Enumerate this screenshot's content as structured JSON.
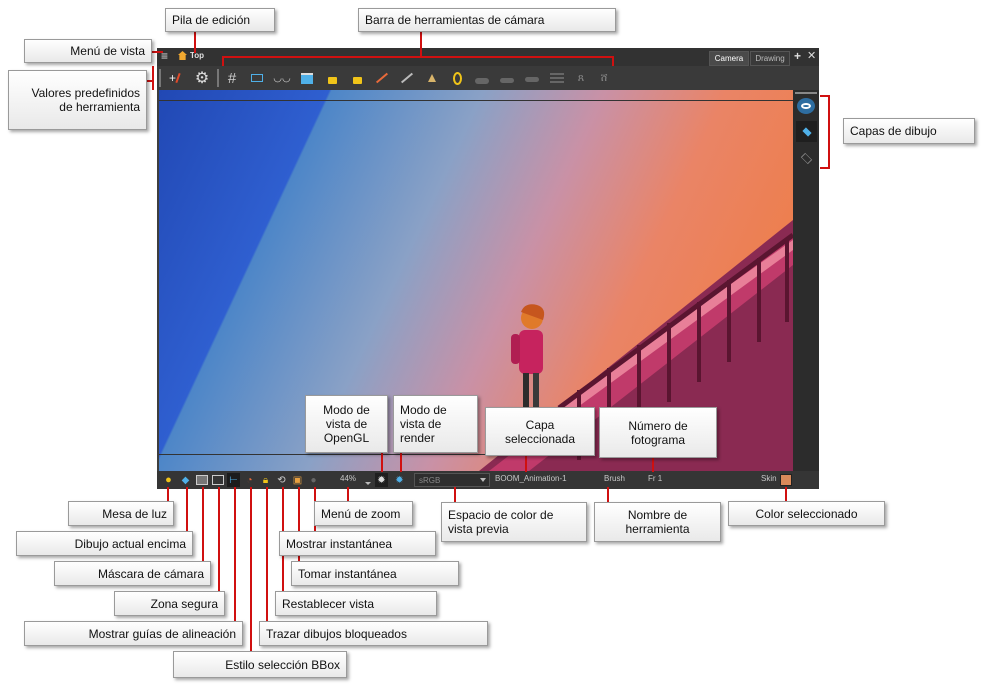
{
  "window": {
    "menu_glyph": "≡",
    "breadcrumb": "Top",
    "tabs": [
      {
        "label": "Camera",
        "active": true
      },
      {
        "label": "Drawing",
        "active": false
      }
    ]
  },
  "toolbar": {
    "icons": [
      "add-preset-icon",
      "gear-icon",
      "grid-icon",
      "field-chart-icon",
      "onion-skin-icon",
      "tracing-icon",
      "lock-icon",
      "lock-all-icon",
      "ruler-icon",
      "ruler-alt-icon",
      "light-icon",
      "egg-icon",
      "front-view-icon",
      "side-view-icon",
      "top-view-icon",
      "stack-icon",
      "pegs-icon",
      "bones-icon"
    ]
  },
  "statusbar": {
    "zoom": "44%",
    "color_space": "sRGB",
    "selected_layer": "BOOM_Animation-1",
    "tool_name": "Brush",
    "frame": "Fr 1",
    "color_name": "Skin",
    "color_swatch": "#d98a5a"
  },
  "colors": {
    "accent_line": "#d01010"
  },
  "callouts": {
    "pila_edicion": "Pila de edición",
    "barra_camara": "Barra de herramientas de cámara",
    "menu_vista": "Menú de vista",
    "valores_predefinidos": "Valores predefinidos de herramienta",
    "capas_dibujo": "Capas de dibujo",
    "modo_opengl": "Modo de vista de OpenGL",
    "modo_render": "Modo de vista de render",
    "capa_seleccionada": "Capa seleccionada",
    "numero_fotograma": "Número de fotograma",
    "mesa_luz": "Mesa de luz",
    "dibujo_encima": "Dibujo actual encima",
    "mascara_camara": "Máscara de cámara",
    "zona_segura": "Zona segura",
    "guias_alineacion": "Mostrar guías de alineación",
    "estilo_bbox": "Estilo selección BBox",
    "menu_zoom": "Menú de zoom",
    "mostrar_instantanea": "Mostrar instantánea",
    "tomar_instantanea": "Tomar instantánea",
    "restablecer_vista": "Restablecer vista",
    "trazar_bloqueados": "Trazar dibujos bloqueados",
    "espacio_color": "Espacio de color de vista previa",
    "nombre_herramienta": "Nombre de herramienta",
    "color_seleccionado": "Color seleccionado"
  }
}
